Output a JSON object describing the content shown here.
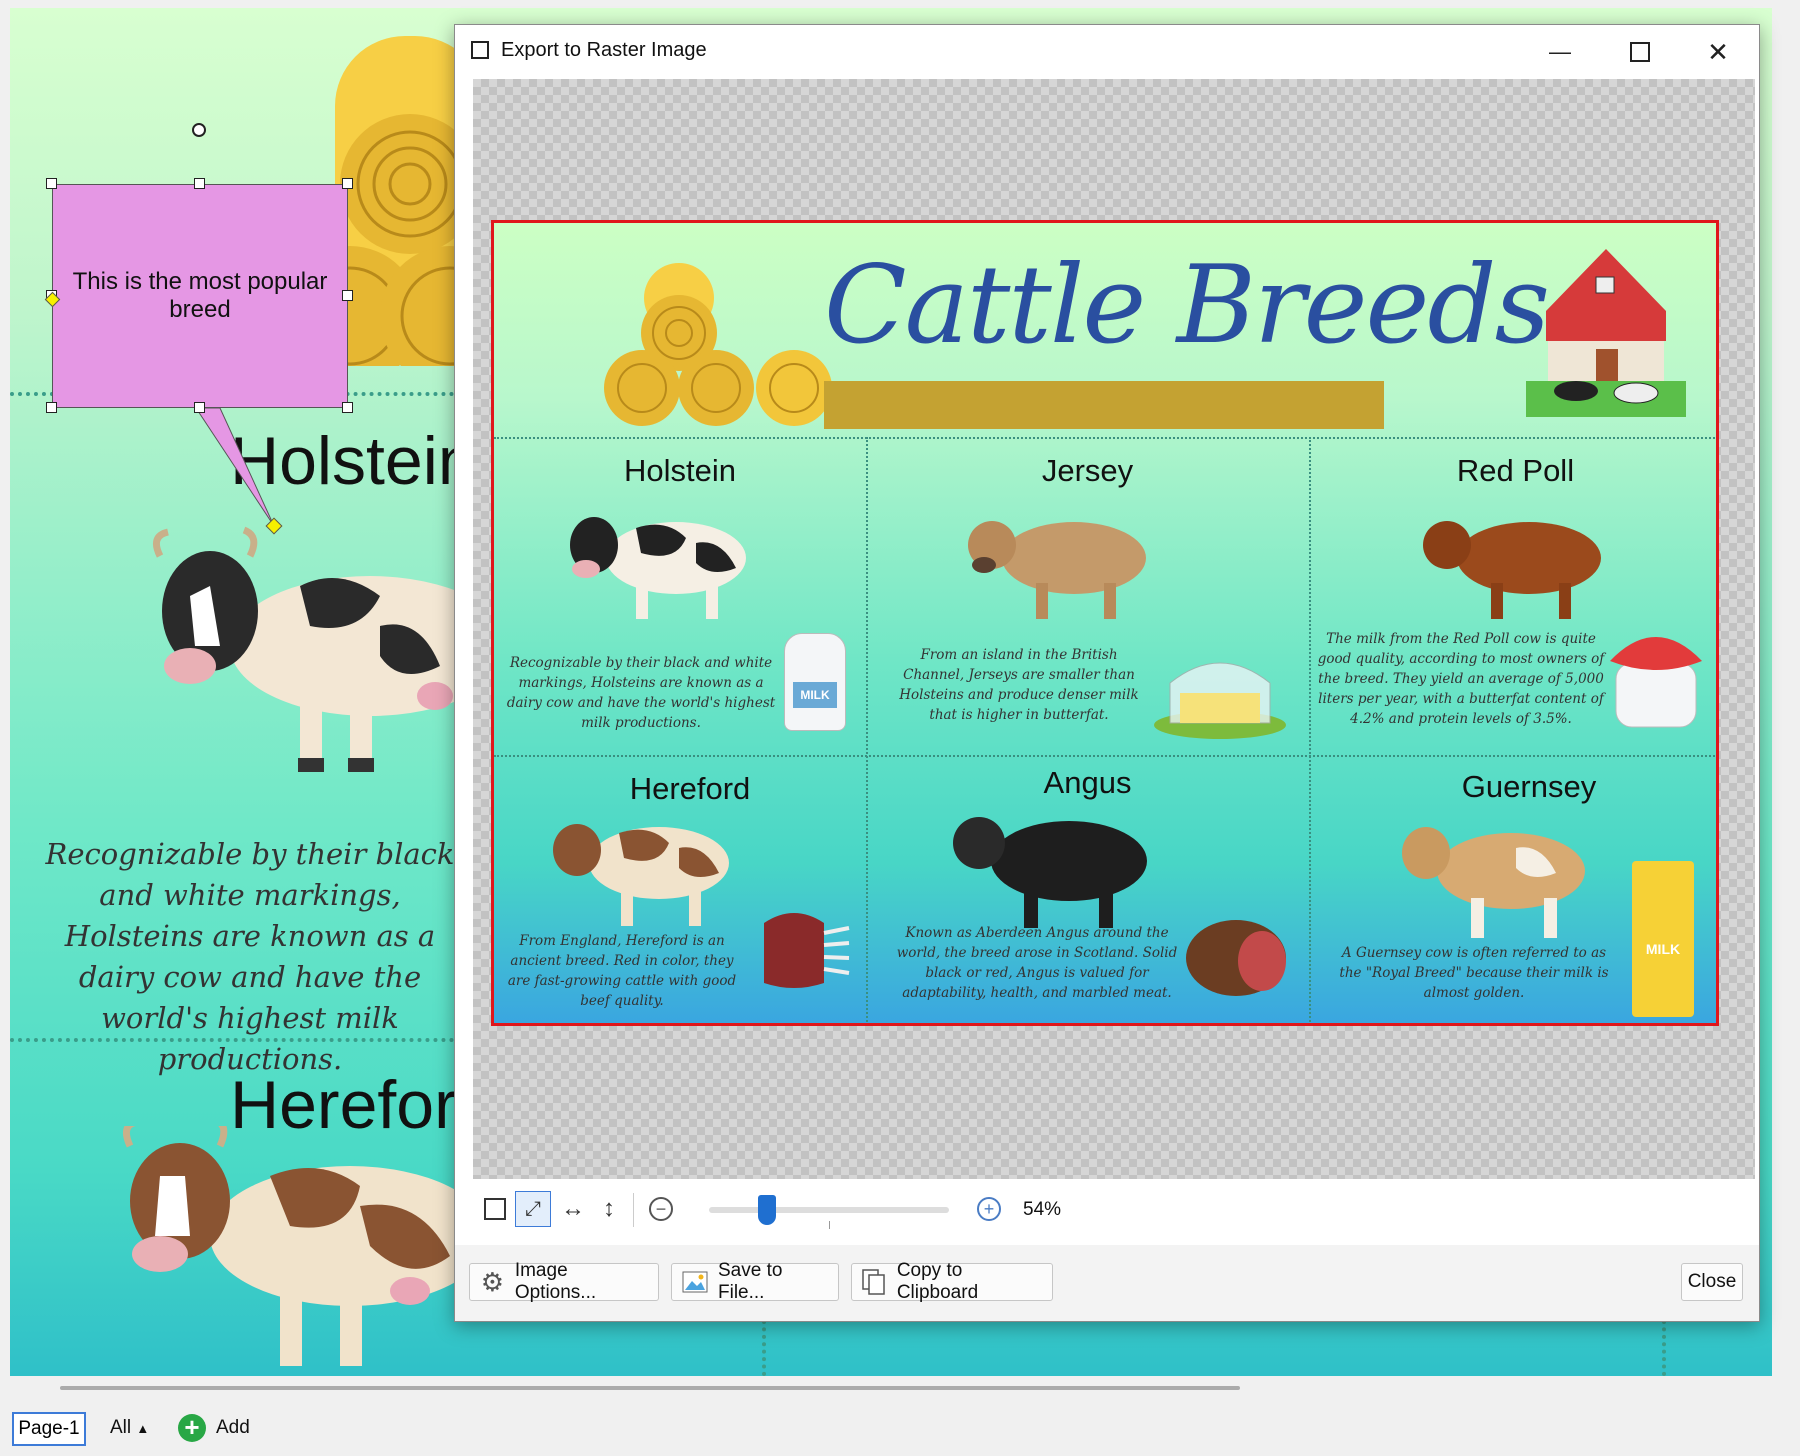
{
  "canvas": {
    "callout_text": "This is the most popular breed",
    "holstein_title": "Holstein",
    "holstein_desc": "Recognizable by their black and white markings, Holsteins are known as a dairy cow and have the world's highest milk productions.",
    "hereford_title": "Hereford"
  },
  "dialog": {
    "title": "Export to Raster Image",
    "zoom_level": "54%",
    "zoom_slider_fraction": 0.24,
    "buttons": {
      "image_options": "Image Options...",
      "save_to_file": "Save to File...",
      "copy_to_clipboard": "Copy to Clipboard",
      "close": "Close"
    }
  },
  "infographic": {
    "title": "Cattle Breeds",
    "breeds": [
      {
        "name": "Holstein",
        "desc": "Recognizable by their black and white markings, Holsteins are known as a dairy cow and have the world's highest milk productions.",
        "product": "milk-jug",
        "product_label": "MILK"
      },
      {
        "name": "Jersey",
        "desc": "From an island in the British Channel, Jerseys are smaller than Holsteins and produce denser milk that is higher in butterfat.",
        "product": "butter"
      },
      {
        "name": "Red Poll",
        "desc": "The milk from the Red Poll cow is quite good quality, according to most owners of the breed. They yield an average of 5,000 liters per year, with a butterfat content of 4.2% and protein levels of 3.5%.",
        "product": "yogurt-jar"
      },
      {
        "name": "Hereford",
        "desc": "From England, Hereford is an ancient breed. Red in color, they are fast-growing cattle with good beef quality.",
        "product": "rack-of-beef"
      },
      {
        "name": "Angus",
        "desc": "Known as Aberdeen Angus around the world, the breed arose in Scotland. Solid black or red, Angus is valued for adaptability, health, and marbled meat.",
        "product": "roast-beef"
      },
      {
        "name": "Guernsey",
        "desc": "A Guernsey cow is often referred to as the \"Royal Breed\" because their milk is almost golden.",
        "product": "milk-carton",
        "product_label": "MILK"
      }
    ]
  },
  "pagebar": {
    "page_tab": "Page-1",
    "all_label": "All",
    "add_label": "Add"
  },
  "colors": {
    "selection_red": "#e0161b",
    "title_blue": "#2a4fa0",
    "callout_pink": "#e597e4",
    "accent_blue": "#3d7bd8"
  }
}
